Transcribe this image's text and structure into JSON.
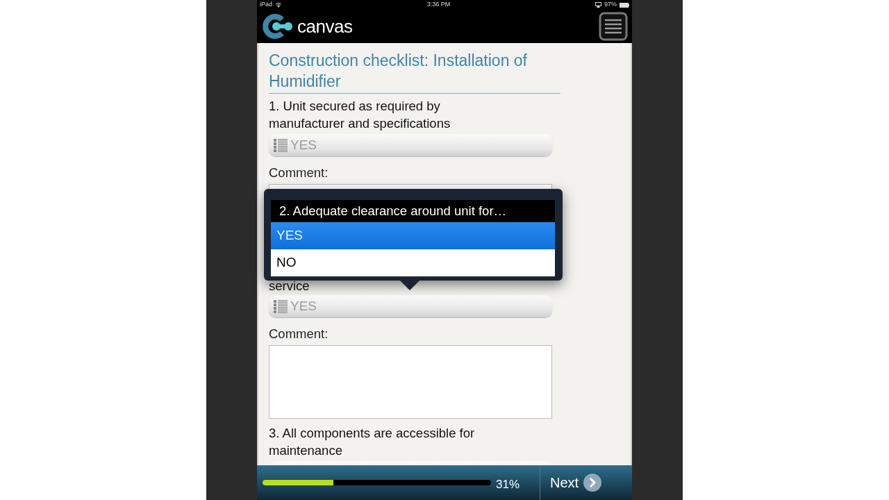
{
  "status_bar": {
    "device": "iPad",
    "time": "3:36 PM",
    "battery": "97%"
  },
  "header": {
    "logo": "canvas"
  },
  "form": {
    "title": "Construction checklist: Installation of Humidifier",
    "items": [
      {
        "question": "1. Unit secured as required by manufacturer and specifications",
        "answer": "YES",
        "comment_label": "Comment:"
      },
      {
        "question": "service",
        "answer": "YES",
        "comment_label": "Comment:"
      },
      {
        "question": "3. All components are accessible for maintenance"
      }
    ]
  },
  "picker": {
    "title": "2. Adequate clearance around unit for…",
    "options": [
      {
        "label": "YES",
        "selected": true
      },
      {
        "label": "NO",
        "selected": false
      }
    ]
  },
  "footer": {
    "progress": {
      "level": 0.31,
      "reading": "31%"
    },
    "next": "Next"
  }
}
